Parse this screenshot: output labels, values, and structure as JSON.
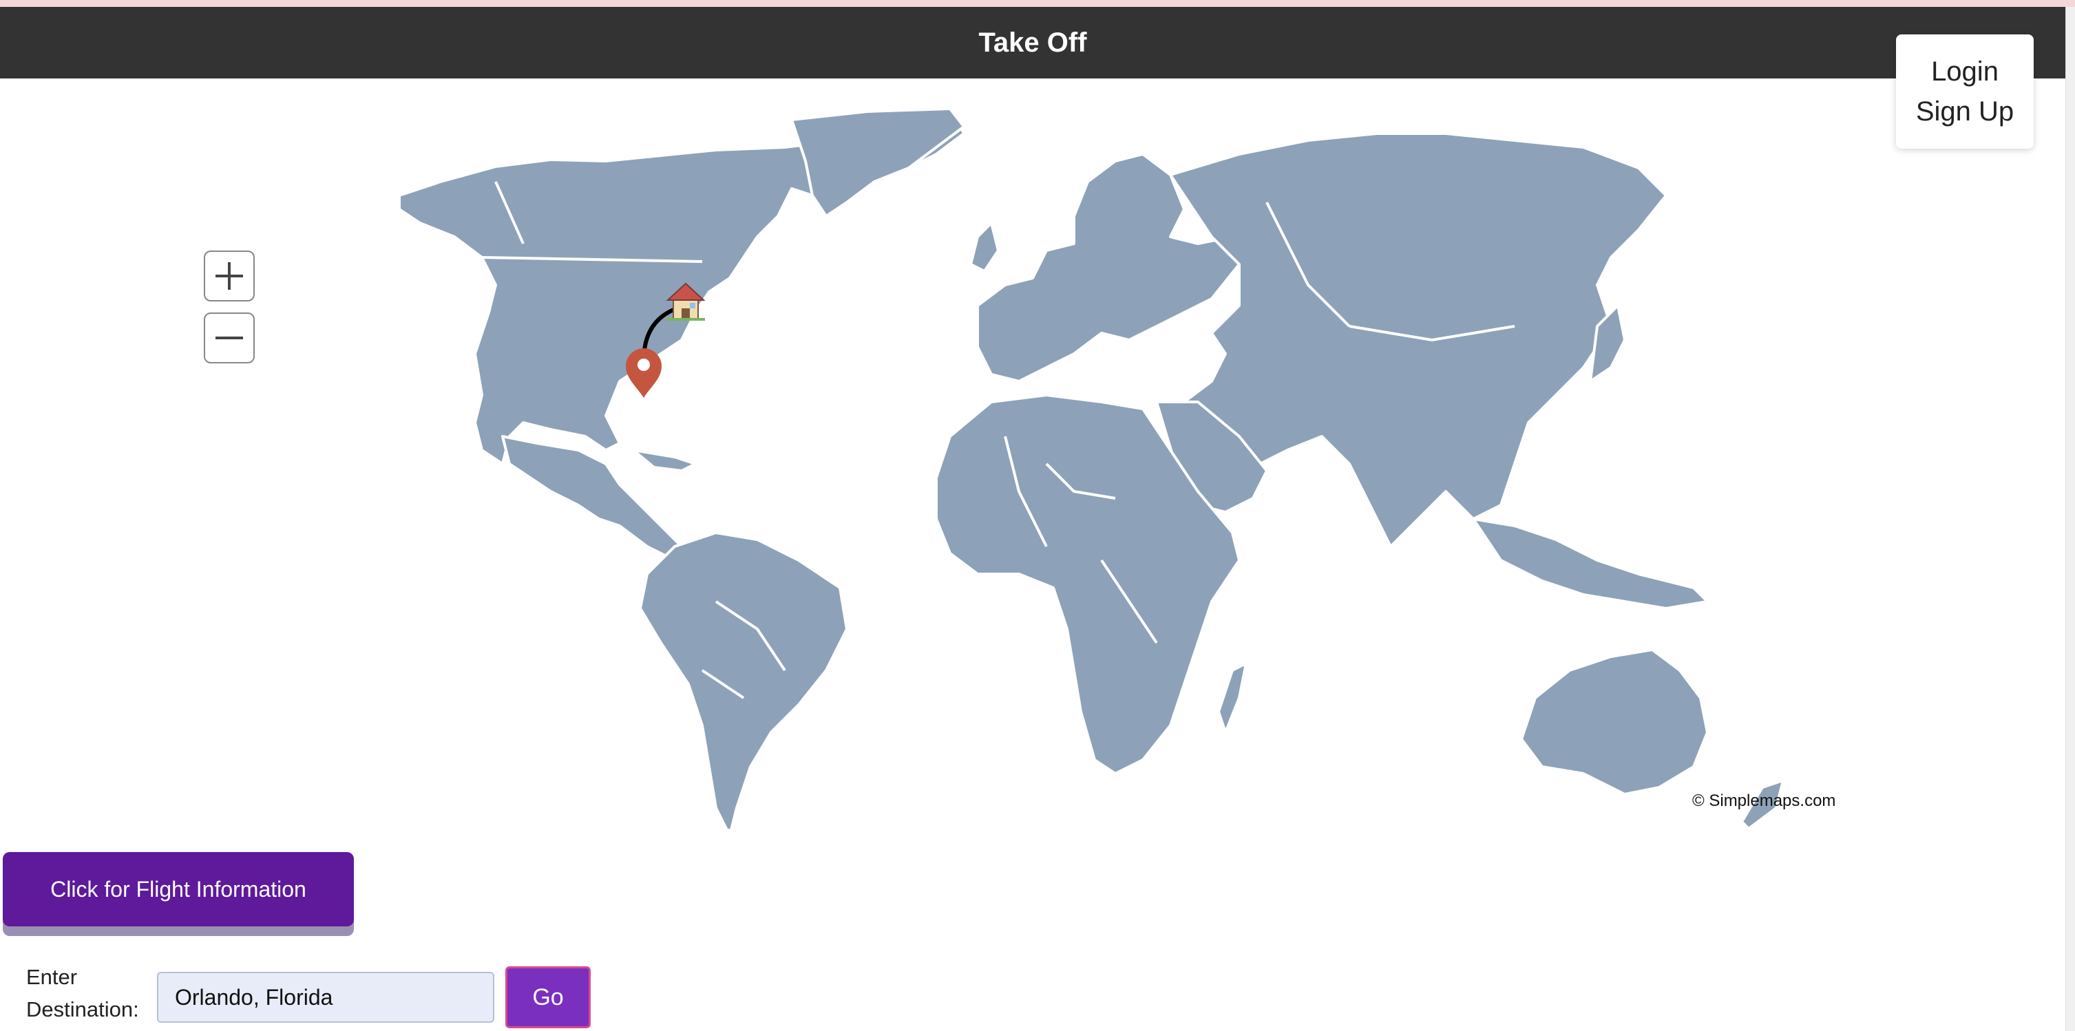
{
  "header": {
    "title": "Take Off"
  },
  "auth": {
    "login": "Login",
    "signup": "Sign Up"
  },
  "map": {
    "credit": "© Simplemaps.com",
    "land_color": "#8da2b8",
    "home_marker_icon": "house-icon",
    "destination_marker_icon": "map-pin-icon"
  },
  "actions": {
    "flight_info_label": "Click for Flight Information"
  },
  "destination": {
    "label_line1": "Enter",
    "label_line2": "Destination:",
    "value": "Orlando, Florida",
    "go_label": "Go"
  },
  "colors": {
    "header_bg": "#333333",
    "primary": "#5e1a9a",
    "go_button": "#7b2fbf",
    "pin": "#c4563f"
  }
}
